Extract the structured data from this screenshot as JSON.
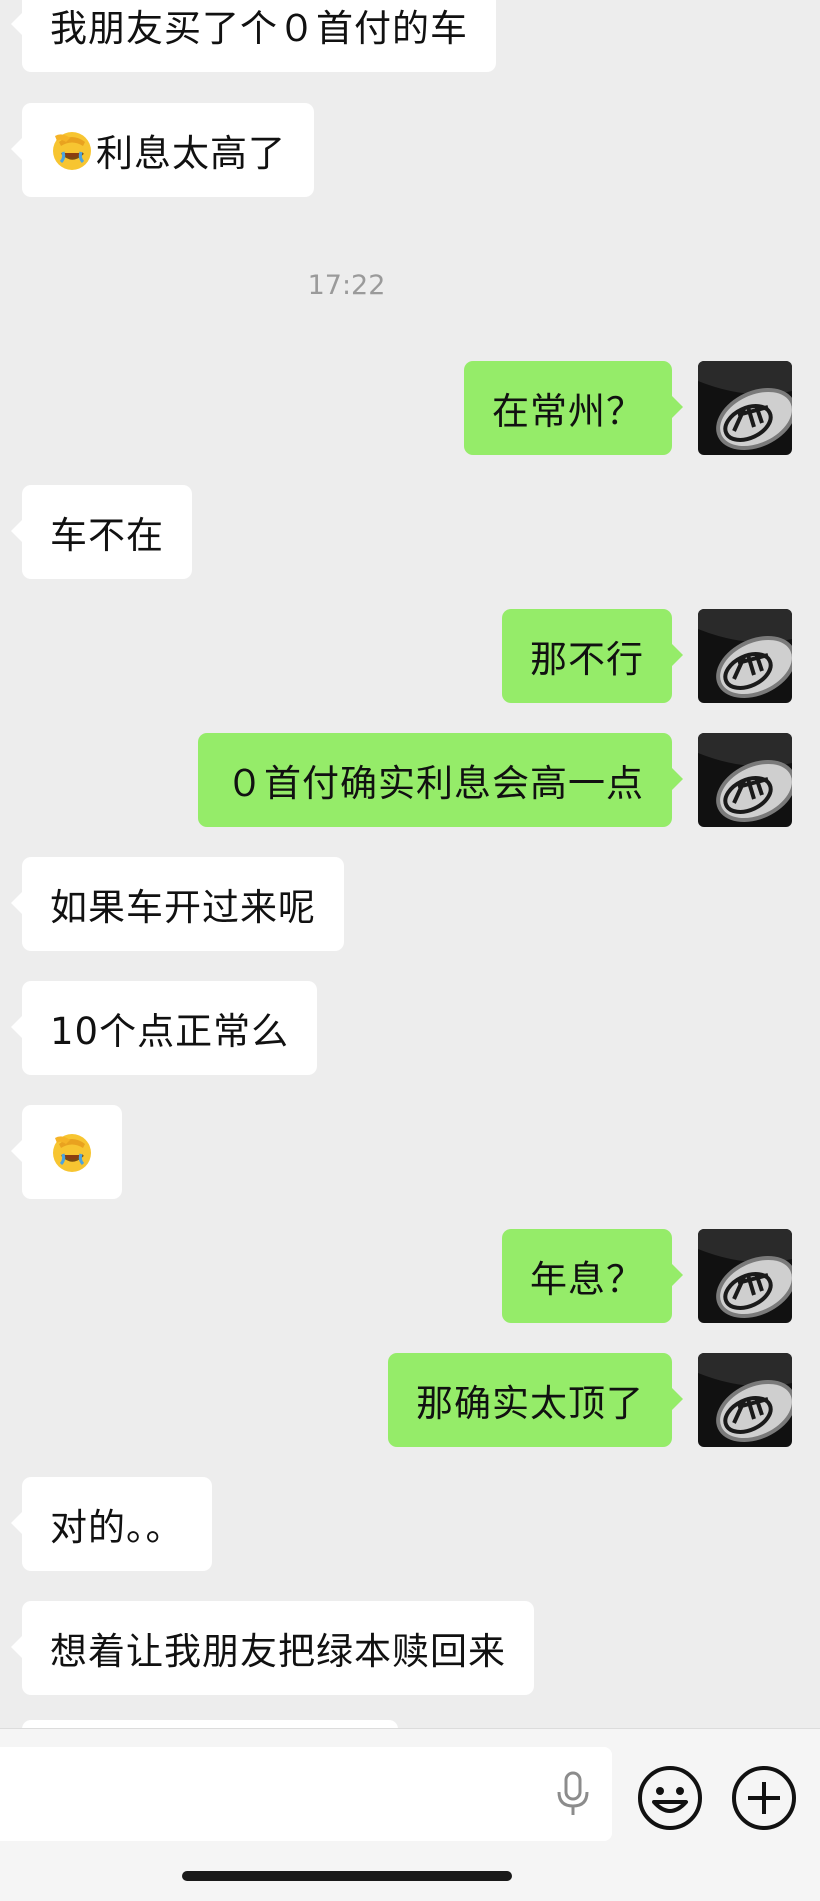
{
  "chat": {
    "timestamp": "17:22",
    "messages": [
      {
        "side": "in",
        "text": "我朋友买了个０首付的车"
      },
      {
        "side": "in",
        "emoji": "facepalm-crying-emoji",
        "text": "利息太高了"
      },
      {
        "side": "out",
        "text": "在常州？"
      },
      {
        "side": "in",
        "text": "车不在"
      },
      {
        "side": "out",
        "text": "那不行"
      },
      {
        "side": "out",
        "text": "０首付确实利息会高一点"
      },
      {
        "side": "in",
        "text": "如果车开过来呢"
      },
      {
        "side": "in",
        "text": "10个点正常么"
      },
      {
        "side": "in",
        "emoji": "facepalm-crying-emoji",
        "text": ""
      },
      {
        "side": "out",
        "text": "年息？"
      },
      {
        "side": "out",
        "text": "那确实太顶了"
      },
      {
        "side": "in",
        "text": "对的。。"
      },
      {
        "side": "in",
        "text": "想着让我朋友把绿本赎回来"
      }
    ]
  },
  "input_bar": {
    "voice_icon": "microphone-icon",
    "emoji_icon": "smiley-icon",
    "more_icon": "plus-circle-icon"
  },
  "colors": {
    "background": "#ededed",
    "incoming_bubble": "#ffffff",
    "outgoing_bubble": "#95ec69",
    "timestamp": "#9a9a9a"
  }
}
